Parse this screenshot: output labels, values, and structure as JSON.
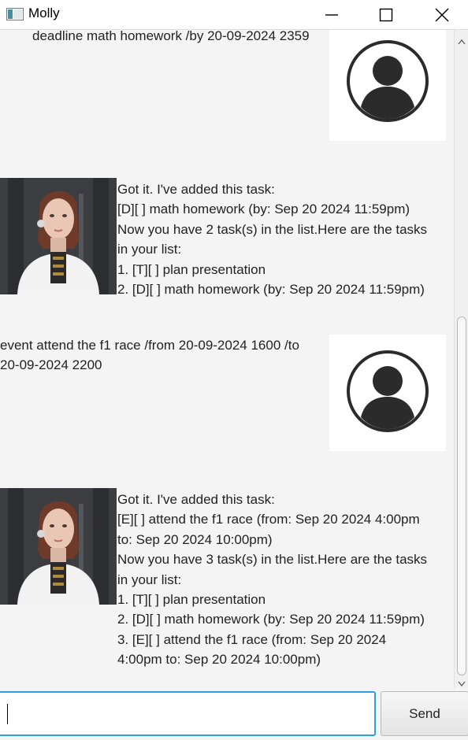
{
  "window": {
    "title": "Molly",
    "app_icon": "app-window-icon",
    "controls": [
      "minimize-icon",
      "maximize-icon",
      "close-icon"
    ]
  },
  "messages": [
    {
      "sender": "user",
      "text": "deadline math homework /by 20-09-2024 2359"
    },
    {
      "sender": "bot",
      "text": "Got it. I've added this task:\n[D][ ] math homework (by: Sep 20 2024 11:59pm)\nNow you have 2 task(s) in the list.Here are the tasks\nin your list:\n1. [T][ ] plan presentation\n2. [D][ ] math homework (by: Sep 20 2024 11:59pm)"
    },
    {
      "sender": "user",
      "text": "event attend the f1 race /from 20-09-2024 1600 /to\n20-09-2024 2200"
    },
    {
      "sender": "bot",
      "text": "Got it. I've added this task:\n[E][ ] attend the f1 race (from: Sep 20 2024 4:00pm\nto: Sep 20 2024 10:00pm)\nNow you have 3 task(s) in the list.Here are the tasks\nin your list:\n1. [T][ ] plan presentation\n2. [D][ ] math homework (by: Sep 20 2024 11:59pm)\n3. [E][ ] attend the f1 race (from: Sep 20 2024\n4:00pm to: Sep 20 2024 10:00pm)"
    }
  ],
  "input": {
    "value": "",
    "placeholder": ""
  },
  "send_label": "Send",
  "colors": {
    "background": "#f4f4f4",
    "input_focus_border": "#2d9fe3",
    "user_avatar_ring": "#2b2b2b"
  }
}
